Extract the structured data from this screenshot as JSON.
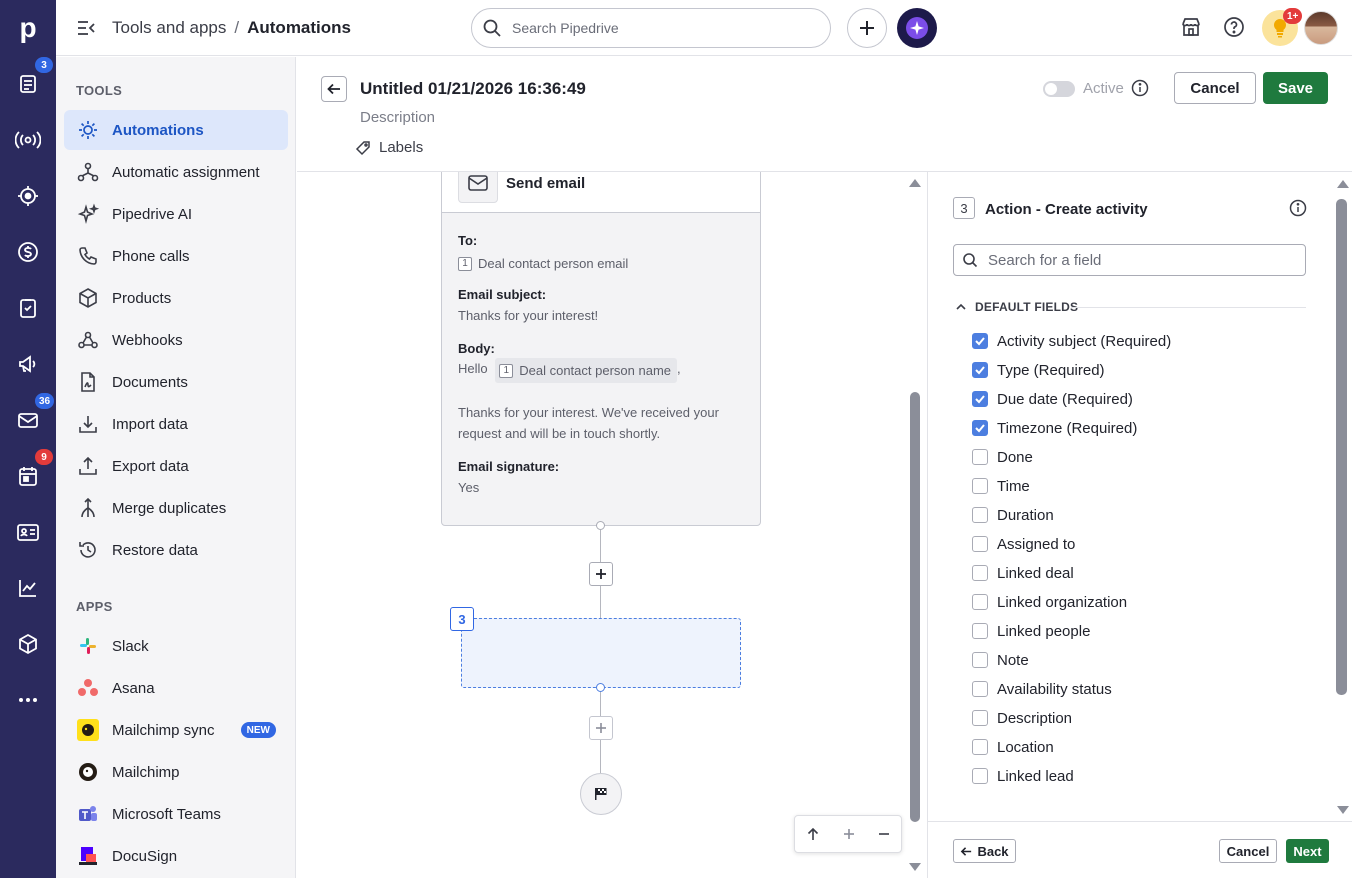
{
  "app": {
    "logo": "p",
    "rail_icons": [
      {
        "name": "deals-icon",
        "badge": "3"
      },
      {
        "name": "leads-icon",
        "badge": ""
      },
      {
        "name": "target-icon",
        "badge": ""
      },
      {
        "name": "dollar-icon",
        "badge": ""
      },
      {
        "name": "tasks-icon",
        "badge": ""
      },
      {
        "name": "campaigns-icon",
        "badge": ""
      },
      {
        "name": "mail-icon",
        "badge": "36"
      },
      {
        "name": "calendar-icon",
        "badge": "9"
      },
      {
        "name": "contacts-icon",
        "badge": ""
      },
      {
        "name": "insights-icon",
        "badge": ""
      },
      {
        "name": "products-rail-icon",
        "badge": ""
      },
      {
        "name": "more-icon",
        "badge": ""
      }
    ]
  },
  "header": {
    "breadcrumb_parent": "Tools and apps",
    "breadcrumb_sep": "/",
    "breadcrumb_current": "Automations",
    "search_placeholder": "Search Pipedrive",
    "notification_badge": "1+"
  },
  "sidebar": {
    "tools_title": "TOOLS",
    "tools": [
      {
        "label": "Automations",
        "icon": "automations-icon",
        "active": true
      },
      {
        "label": "Automatic assignment",
        "icon": "assignment-icon"
      },
      {
        "label": "Pipedrive AI",
        "icon": "ai-sparkle-icon"
      },
      {
        "label": "Phone calls",
        "icon": "phone-icon"
      },
      {
        "label": "Products",
        "icon": "box-icon"
      },
      {
        "label": "Webhooks",
        "icon": "webhooks-icon"
      },
      {
        "label": "Documents",
        "icon": "documents-icon"
      },
      {
        "label": "Import data",
        "icon": "import-icon"
      },
      {
        "label": "Export data",
        "icon": "export-icon"
      },
      {
        "label": "Merge duplicates",
        "icon": "merge-icon"
      },
      {
        "label": "Restore data",
        "icon": "restore-icon"
      }
    ],
    "apps_title": "APPS",
    "apps": [
      {
        "label": "Slack",
        "icon": "slack-icon"
      },
      {
        "label": "Asana",
        "icon": "asana-icon"
      },
      {
        "label": "Mailchimp sync",
        "icon": "mailchimp-sync-icon",
        "badge": "NEW"
      },
      {
        "label": "Mailchimp",
        "icon": "mailchimp-icon"
      },
      {
        "label": "Microsoft Teams",
        "icon": "teams-icon"
      },
      {
        "label": "DocuSign",
        "icon": "docusign-icon"
      }
    ]
  },
  "automation": {
    "title": "Untitled 01/21/2026 16:36:49",
    "description_placeholder": "Description",
    "labels": "Labels",
    "active_label": "Active",
    "active": false,
    "cancel": "Cancel",
    "save": "Save"
  },
  "canvas": {
    "email_step": {
      "title": "Send email",
      "to_label": "To:",
      "to_chip_num": "1",
      "to_value": "Deal contact person email",
      "subject_label": "Email subject:",
      "subject_value": "Thanks for your interest!",
      "body_label": "Body:",
      "body_prefix": "Hello",
      "body_chip_num": "1",
      "body_chip": "Deal contact person name",
      "body_comma": ",",
      "body_line1": "Thanks for your interest. We've received your",
      "body_line2": "request and will be in touch shortly.",
      "signature_label": "Email signature:",
      "signature_value": "Yes"
    },
    "new_step_number": "3"
  },
  "panel": {
    "step_number": "3",
    "title": "Action - Create activity",
    "search_placeholder": "Search for a field",
    "section_title": "DEFAULT FIELDS",
    "fields": [
      {
        "label": "Activity subject (Required)",
        "checked": true
      },
      {
        "label": "Type (Required)",
        "checked": true
      },
      {
        "label": "Due date (Required)",
        "checked": true
      },
      {
        "label": "Timezone (Required)",
        "checked": true
      },
      {
        "label": "Done",
        "checked": false
      },
      {
        "label": "Time",
        "checked": false
      },
      {
        "label": "Duration",
        "checked": false
      },
      {
        "label": "Assigned to",
        "checked": false
      },
      {
        "label": "Linked deal",
        "checked": false
      },
      {
        "label": "Linked organization",
        "checked": false
      },
      {
        "label": "Linked people",
        "checked": false
      },
      {
        "label": "Note",
        "checked": false
      },
      {
        "label": "Availability status",
        "checked": false
      },
      {
        "label": "Description",
        "checked": false
      },
      {
        "label": "Location",
        "checked": false
      },
      {
        "label": "Linked lead",
        "checked": false
      }
    ],
    "back": "Back",
    "cancel": "Cancel",
    "next": "Next"
  },
  "colors": {
    "rail": "#2b2a5e",
    "accent_blue": "#3167e3",
    "save_green": "#1f7a3e",
    "active_item_bg": "#dde7fb"
  }
}
